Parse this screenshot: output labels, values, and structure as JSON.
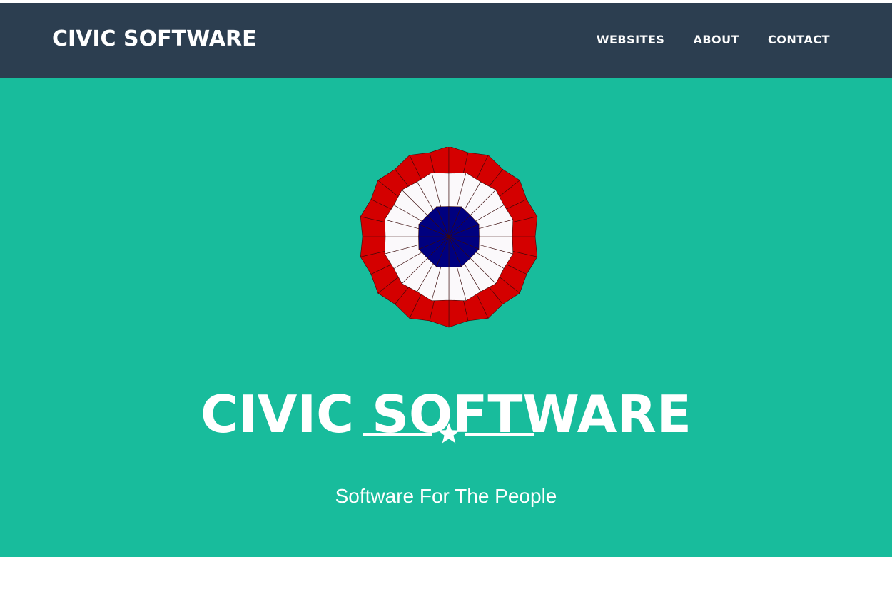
{
  "navbar": {
    "brand": "CIVIC SOFTWARE",
    "links": [
      "WEBSITES",
      "ABOUT",
      "CONTACT"
    ]
  },
  "hero": {
    "title": "CIVIC SOFTWARE",
    "tagline": "Software For The People",
    "logo_icon": "cockade-icon",
    "divider_icon": "star-icon"
  },
  "colors": {
    "navbar_bg": "#2c3e50",
    "hero_bg": "#18bc9c",
    "text": "#ffffff",
    "cockade_red": "#d40000",
    "cockade_white": "#fbf9fb",
    "cockade_blue": "#00007f"
  }
}
